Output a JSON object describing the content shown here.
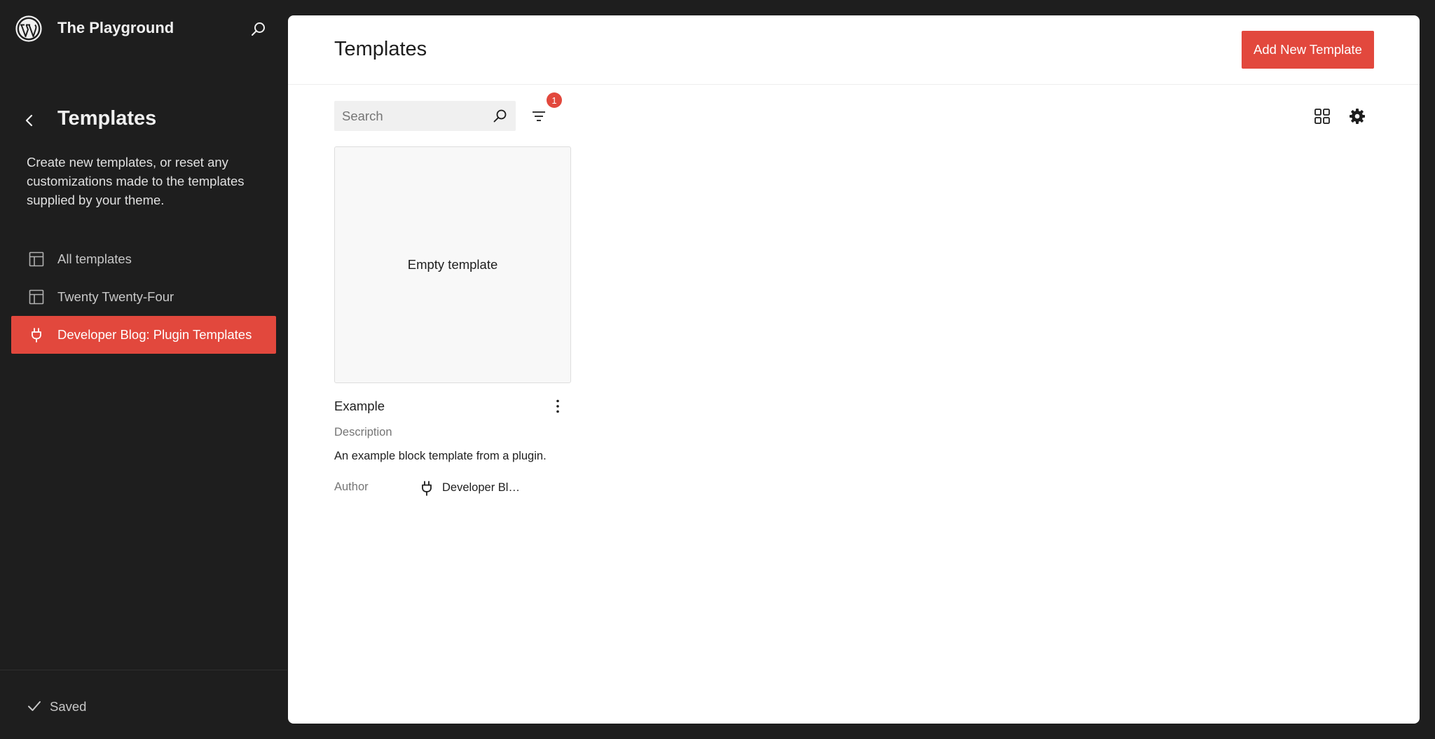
{
  "site": {
    "title": "The Playground"
  },
  "sidebar": {
    "title": "Templates",
    "description": "Create new templates, or reset any customizations made to the templates supplied by your theme.",
    "items": [
      {
        "label": "All templates",
        "icon": "layout-icon",
        "active": false
      },
      {
        "label": "Twenty Twenty-Four",
        "icon": "layout-icon",
        "active": false
      },
      {
        "label": "Developer Blog: Plugin Templates",
        "icon": "plugin-icon",
        "active": true
      }
    ],
    "footer": {
      "status": "Saved",
      "icon": "check-icon"
    }
  },
  "main": {
    "title": "Templates",
    "add_button": "Add New Template",
    "search": {
      "placeholder": "Search",
      "value": ""
    },
    "filter_count": "1",
    "card": {
      "preview_text": "Empty template",
      "title": "Example",
      "description_label": "Description",
      "description": "An example block template from a plugin.",
      "author_label": "Author",
      "author": "Developer Blog: Plugin Templates"
    }
  },
  "colors": {
    "accent": "#e2483d",
    "sidebar_bg": "#1e1e1e",
    "panel_bg": "#ffffff"
  }
}
